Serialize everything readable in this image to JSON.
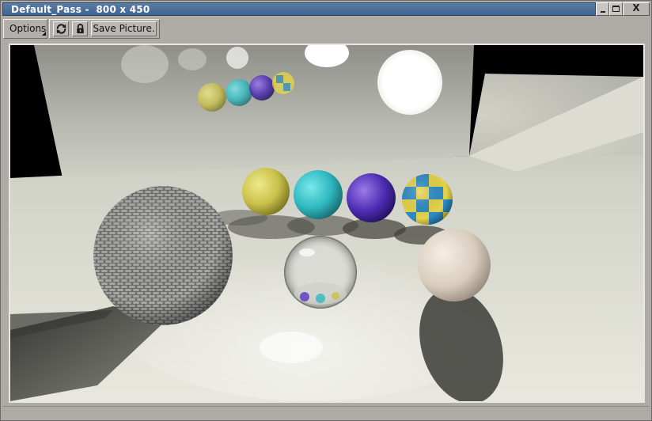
{
  "window": {
    "title": "Default_Pass -  800 x 450",
    "controls": {
      "minimize_icon": "minimize-icon",
      "maximize_icon": "maximize-icon",
      "close_label": "X"
    }
  },
  "toolbar": {
    "options_label": "Options",
    "refresh_icon": "refresh-icon",
    "lock_icon": "lock-icon",
    "save_label": "Save Picture."
  },
  "render": {
    "scene": "rendered-scene",
    "colors": {
      "yellow_ball": "#d9d35a",
      "cyan_ball": "#35c9cf",
      "purple_ball": "#5a35c2",
      "checker_yellow": "#e4d34a",
      "checker_blue": "#2d8cc5",
      "white_ball": "#efe4d8",
      "floor": "#e6e6dc",
      "backdrop": "#000000"
    }
  },
  "colors": {
    "title_bar": "#4a6d98",
    "window_bg": "#aeaaa5"
  }
}
